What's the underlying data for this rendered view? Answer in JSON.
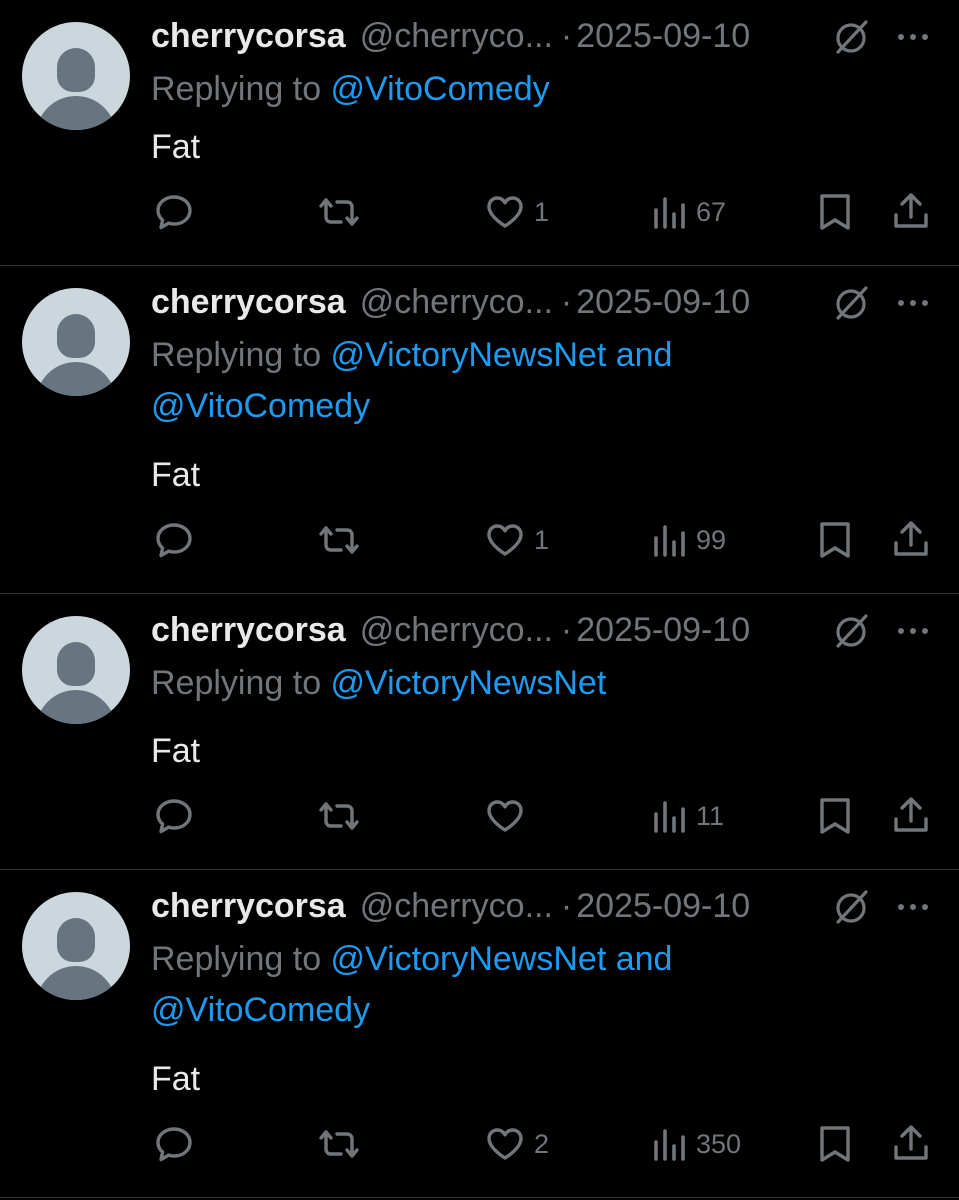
{
  "tweets": [
    {
      "name": "cherrycorsa",
      "handle": "@cherryco...",
      "sep": "·",
      "date": "2025-09-10",
      "replying_prefix": "Replying to ",
      "mentions": "@VitoComedy",
      "text": "Fat",
      "likes": "1",
      "views": "67"
    },
    {
      "name": "cherrycorsa",
      "handle": "@cherryco...",
      "sep": "·",
      "date": "2025-09-10",
      "replying_prefix": "Replying to ",
      "mentions": "@VictoryNewsNet and @VitoComedy",
      "text": "Fat",
      "likes": "1",
      "views": "99"
    },
    {
      "name": "cherrycorsa",
      "handle": "@cherryco...",
      "sep": "·",
      "date": "2025-09-10",
      "replying_prefix": "Replying to ",
      "mentions": "@VictoryNewsNet",
      "text": "Fat",
      "likes": "",
      "views": "11"
    },
    {
      "name": "cherrycorsa",
      "handle": "@cherryco...",
      "sep": "·",
      "date": "2025-09-10",
      "replying_prefix": "Replying to ",
      "mentions": "@VictoryNewsNet and @VitoComedy",
      "text": "Fat",
      "likes": "2",
      "views": "350"
    }
  ],
  "icons": {
    "reply": "reply-icon",
    "retweet": "retweet-icon",
    "like": "heart-icon",
    "views": "views-icon",
    "bookmark": "bookmark-icon",
    "share": "share-icon",
    "grok": "grok-icon",
    "more": "more-icon"
  },
  "colors": {
    "background": "#000000",
    "text": "#e7e9ea",
    "muted": "#71767b",
    "link": "#1d9bf0",
    "divider": "#2f3336"
  }
}
